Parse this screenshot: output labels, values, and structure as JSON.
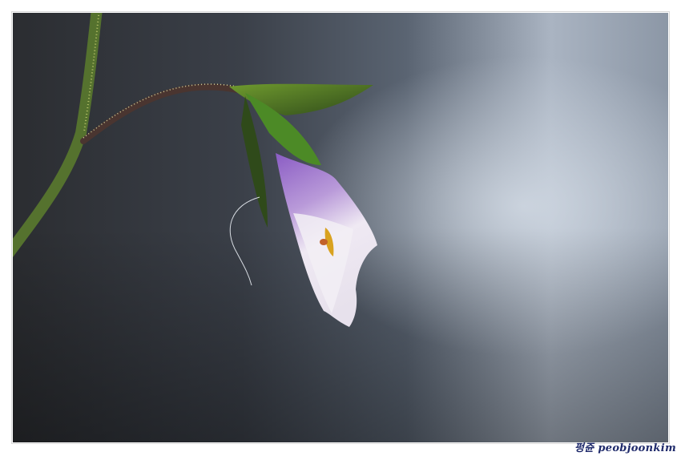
{
  "photo": {
    "subject": "purple-white-flower",
    "palette": {
      "background_dark": "#2a2d33",
      "background_mid": "#4a5260",
      "background_light": "#b8c2cf",
      "stem": "#4f6b2c",
      "sepal": "#5f8a2a",
      "petal_purple": "#8a5cc4",
      "petal_white": "#efe9f3",
      "anther": "#d9a21f"
    }
  },
  "watermark": {
    "text": "펑쥰 peobjoonkim"
  }
}
